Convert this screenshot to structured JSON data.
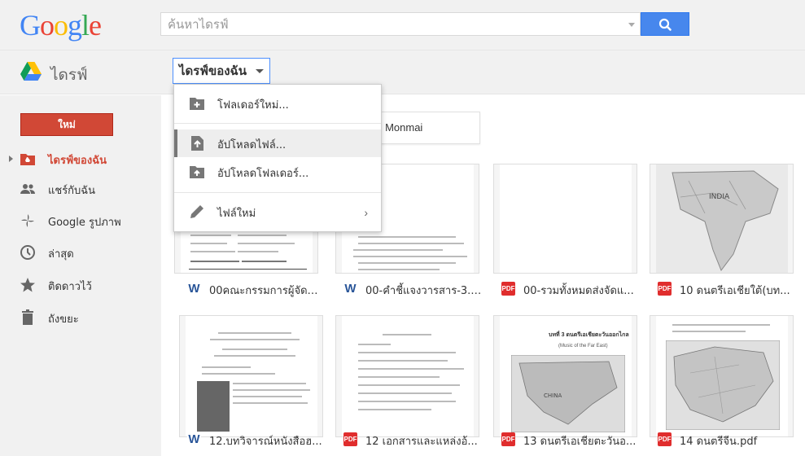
{
  "header": {
    "logo_text": "Google",
    "logo_colors": [
      "#4285f4",
      "#ea4335",
      "#fbbc05",
      "#4285f4",
      "#34a853",
      "#ea4335"
    ],
    "search_placeholder": "ค้นหาไดรฟ์"
  },
  "appbar": {
    "title": "ไดรฟ์",
    "location_label": "ไดรฟ์ของฉัน"
  },
  "sidebar": {
    "new_button": "ใหม่",
    "items": [
      {
        "label": "ไดรฟ์ของฉัน",
        "icon": "my-drive-icon",
        "active": true
      },
      {
        "label": "แชร์กับฉัน",
        "icon": "people-icon",
        "active": false
      },
      {
        "label": "Google รูปภาพ",
        "icon": "pinwheel-icon",
        "active": false
      },
      {
        "label": "ล่าสุด",
        "icon": "clock-icon",
        "active": false
      },
      {
        "label": "ติดดาวไว้",
        "icon": "star-icon",
        "active": false
      },
      {
        "label": "ถังขยะ",
        "icon": "trash-icon",
        "active": false
      }
    ]
  },
  "new_menu": {
    "items": [
      {
        "label": "โฟลเดอร์ใหม่...",
        "icon": "new-folder-icon"
      },
      {
        "label": "อัปโหลดไฟล์...",
        "icon": "upload-file-icon"
      },
      {
        "label": "อัปโหลดโฟลเดอร์...",
        "icon": "upload-folder-icon"
      },
      {
        "label": "ไฟล์ใหม่",
        "icon": "pencil-icon"
      }
    ]
  },
  "folders": [
    {
      "label": "ag Monmai"
    }
  ],
  "files": [
    {
      "name": "00คณะกรรมการผู้จัดทำ...",
      "type": "W"
    },
    {
      "name": "00-คำชี้แจงวารสาร-3.d...",
      "type": "W"
    },
    {
      "name": "00-รวมทั้งหมดส่งจัดแ...",
      "type": "PDF"
    },
    {
      "name": "10 ดนตรีเอเชียใต้(บท...",
      "type": "PDF"
    },
    {
      "name": "12.บทวิจารณ์หนังสือฮ...",
      "type": "W"
    },
    {
      "name": "12 เอกสารและแหล่งอ้...",
      "type": "PDF"
    },
    {
      "name": "13 ดนตรีเอเชียตะวันอ...",
      "type": "PDF"
    },
    {
      "name": "14 ดนตรีจีน.pdf",
      "type": "PDF"
    }
  ],
  "thumb_texts": {
    "music_title": "บทที่ 3 ดนตรีเอเชียตะวันออกไกล",
    "music_subtitle": "(Music of the Far East)",
    "map_label_india": "INDIA",
    "map_label_china": "CHINA"
  }
}
